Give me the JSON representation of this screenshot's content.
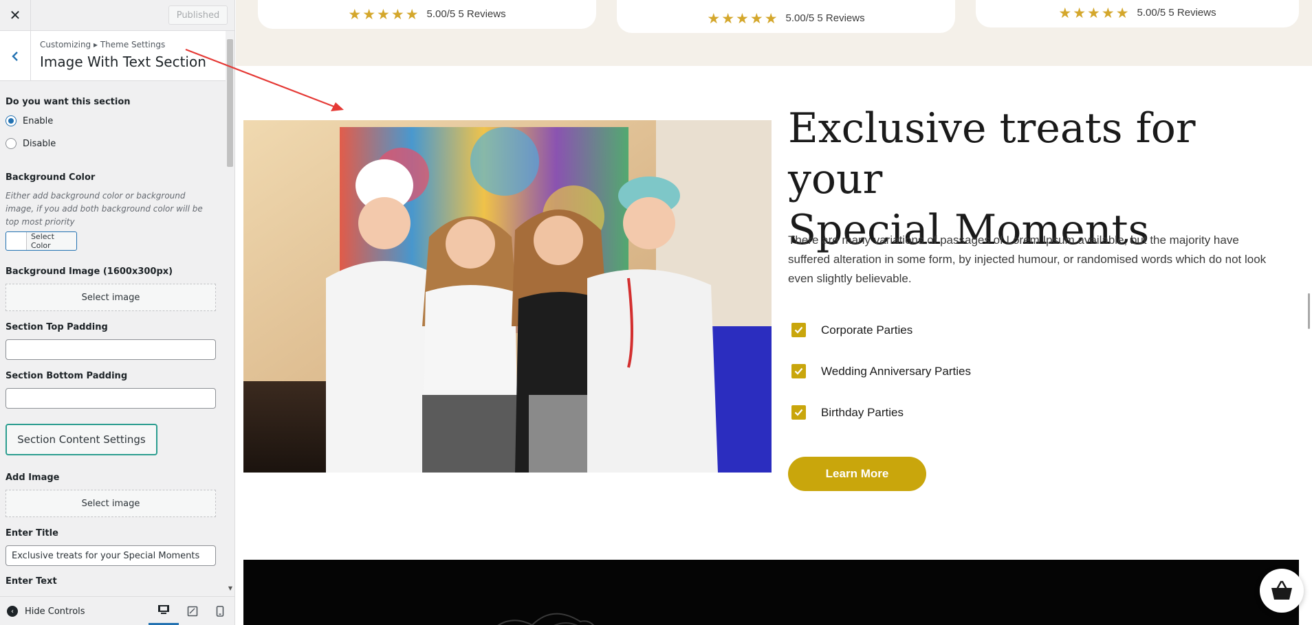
{
  "customizer": {
    "close_label": "✕",
    "published_label": "Published",
    "breadcrumb": "Customizing ▸ Theme Settings",
    "section_title": "Image With Text Section",
    "want_section_label": "Do you want this section",
    "radio_options": [
      "Enable",
      "Disable"
    ],
    "radio_selected": "Enable",
    "bg_color_label": "Background Color",
    "bg_color_description": "Either add background color or background image, if you add both background color will be top most priority",
    "select_color_label": "Select Color",
    "bg_image_label": "Background Image (1600x300px)",
    "select_image_label": "Select image",
    "top_padding_label": "Section Top Padding",
    "top_padding_value": "",
    "bottom_padding_label": "Section Bottom Padding",
    "bottom_padding_value": "",
    "section_content_button": "Section Content Settings",
    "add_image_label": "Add Image",
    "add_image_button": "Select image",
    "enter_title_label": "Enter Title",
    "enter_title_value": "Exclusive treats for your Special Moments",
    "enter_text_label": "Enter Text",
    "hide_controls_label": "Hide Controls",
    "devices": [
      "desktop",
      "tablet",
      "mobile"
    ],
    "active_device": "desktop"
  },
  "preview": {
    "reviews": [
      {
        "rating_text": "5.00/5 5 Reviews",
        "stars": 5
      },
      {
        "rating_text": "5.00/5 5 Reviews",
        "stars": 5
      },
      {
        "rating_text": "5.00/5 5 Reviews",
        "stars": 5
      }
    ],
    "title": "Exclusive treats for your Special Moments",
    "title_line_1": "Exclusive treats for your",
    "title_line_2": "Special Moments",
    "text": "There are many variations of passages of Lorem Ipsum available, but the majority have suffered alteration in some form, by injected humour, or randomised words which do not look even slightly believable.",
    "features": [
      "Corporate Parties",
      "Wedding Anniversary Parties",
      "Birthday Parties"
    ],
    "button_label": "Learn More"
  },
  "colors": {
    "accent_gold": "#c9a60c",
    "star_gold": "#d4a72c",
    "wp_blue": "#2271b1",
    "teal_button_border": "#2a9d8f",
    "annotation_arrow": "#e53935",
    "reviews_band_bg": "#f4f0e9"
  },
  "icons": {
    "close": "close-icon",
    "back": "chevron-left-icon",
    "hide_controls": "hide-controls-icon",
    "desktop": "desktop-icon",
    "tablet": "tablet-icon",
    "mobile": "mobile-icon",
    "basket": "basket-icon",
    "check": "check-icon",
    "star": "star-icon"
  }
}
